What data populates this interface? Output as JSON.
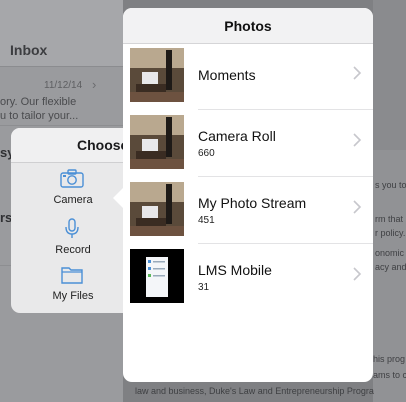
{
  "background": {
    "inbox_title": "Inbox",
    "date": "11/12/14",
    "snippet_line1": "ory. Our flexible",
    "snippet_line2": "u to tailor your...",
    "left_fragment_a": "sy",
    "left_fragment_b": "rsit",
    "right_lines": [
      "s you to",
      "rm that l",
      "r policy.",
      "onomic",
      "acy and"
    ],
    "bottom_lines": [
      "his prog",
      "ams to cou",
      "law and business, Duke's Law and Entrepreneurship Progra"
    ]
  },
  "choose_popover": {
    "title": "Choose",
    "items": [
      {
        "label": "Camera",
        "icon": "camera-icon"
      },
      {
        "label": "Record",
        "icon": "microphone-icon"
      },
      {
        "label": "My Files",
        "icon": "folder-icon"
      }
    ]
  },
  "photos_popover": {
    "title": "Photos",
    "albums": [
      {
        "name": "Moments",
        "count": ""
      },
      {
        "name": "Camera Roll",
        "count": "660"
      },
      {
        "name": "My Photo Stream",
        "count": "451"
      },
      {
        "name": "LMS Mobile",
        "count": "31"
      }
    ]
  },
  "colors": {
    "accent": "#4a8fd6",
    "popover_bg": "#ffffff",
    "dim_bg": "#7f8083"
  }
}
